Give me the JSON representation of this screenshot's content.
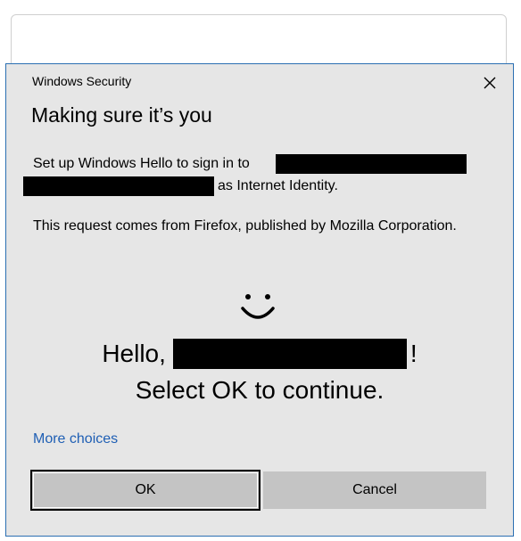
{
  "dialog": {
    "window_title": "Windows Security",
    "heading": "Making sure it’s you",
    "setup_prefix": "Set up Windows Hello to sign in to",
    "setup_suffix": "as Internet Identity.",
    "request_text": "This request comes from Firefox, published by Mozilla Corporation.",
    "hello_prefix": "Hello,",
    "hello_suffix": "!",
    "continue_text": "Select OK to continue.",
    "more_choices": "More choices",
    "ok_label": "OK",
    "cancel_label": "Cancel"
  },
  "colors": {
    "dialog_bg": "#e6e6e6",
    "border": "#2b6fb2",
    "link": "#1f5fb4",
    "button_bg": "#c4c4c4"
  },
  "icons": {
    "close": "close-icon",
    "face": "smiley-face-icon"
  }
}
